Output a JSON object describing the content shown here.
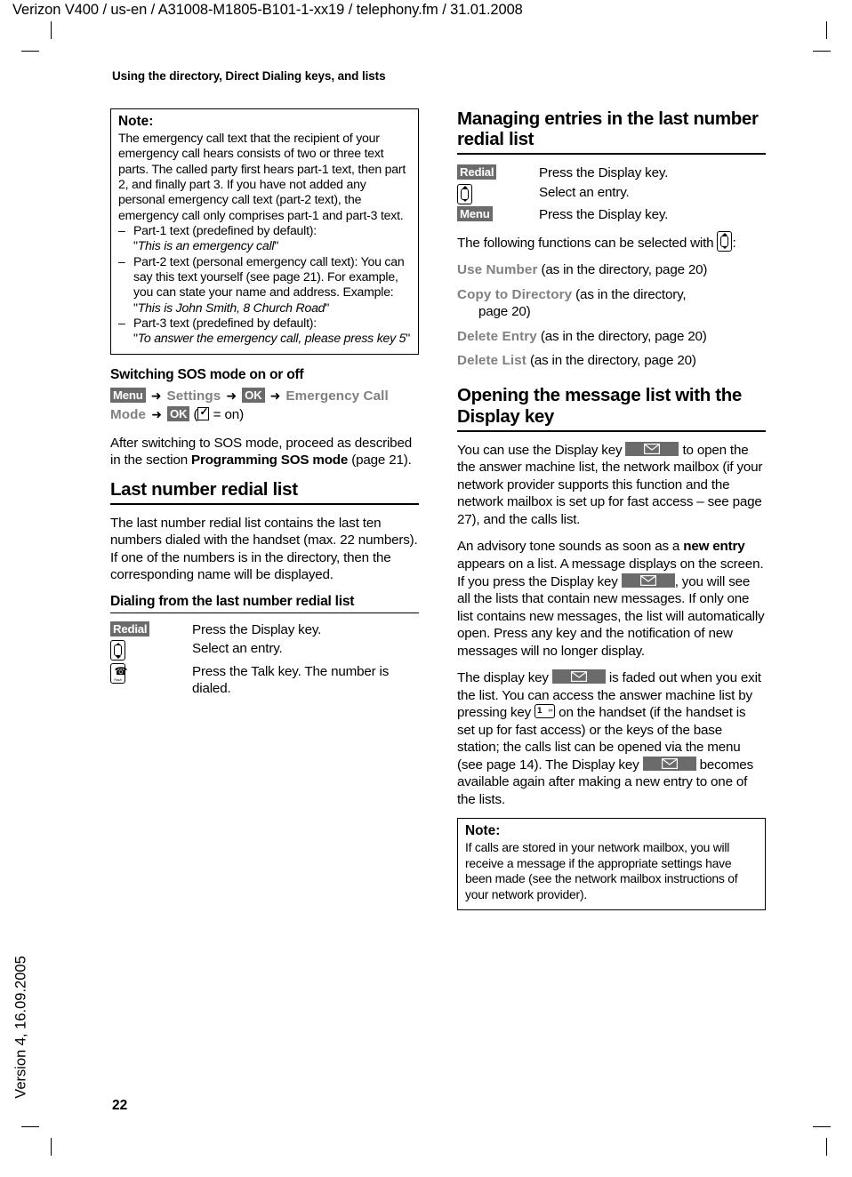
{
  "running_head": "Verizon V400 / us-en / A31008-M1805-B101-1-xx19 / telephony.fm / 31.01.2008",
  "section_title": "Using the directory, Direct Dialing keys, and lists",
  "version_sidebar": "Version 4, 16.09.2005",
  "page_number": "22",
  "colors": {
    "badge_background": "#6b6b6b",
    "badge_text": "#ffffff",
    "menu_word": "#808080",
    "text": "#000000",
    "rule": "#000000"
  },
  "left_column": {
    "note_box": {
      "title": "Note:",
      "paragraph": "The emergency call text that the recipient of your emergency call hears consists of two or three text parts. The called party first hears part-1 text, then part 2, and finally part 3. If you have not added any personal emergency call text (part-2 text), the emergency call only comprises part-1 and part-3 text.",
      "items": [
        {
          "dash": "–",
          "lead": "Part-1 text (predefined by default):",
          "quote_open": "\"",
          "italic": "This is an emergency call",
          "quote_close": "\""
        },
        {
          "dash": "–",
          "lead": "Part-2 text (personal emergency call text): You can say this text yourself (see page 21). For example, you can state your name and address. Example:",
          "quote_open": "\"",
          "italic": "This is John Smith, 8 Church Road",
          "quote_close": "\""
        },
        {
          "dash": "–",
          "lead": "Part-3 text (predefined by default):",
          "quote_open": "\"",
          "italic": "To answer the emergency call, please press key 5",
          "quote_close": "\""
        }
      ]
    },
    "sos_heading": "Switching SOS mode on or off",
    "sos_path": {
      "menu_label": "Menu",
      "arrow": "➜",
      "settings_label": "Settings",
      "ok_label_1": "OK",
      "emergency_label": "Emergency Call Mode",
      "ok_label_2": "OK",
      "paren_open": "(",
      "equals_on": "= on",
      "paren_close": ")"
    },
    "sos_paragraph_pre": "After switching to SOS mode, proceed as described in the section ",
    "sos_paragraph_bold": "Programming SOS mode",
    "sos_paragraph_post": " (page 21).",
    "redial_heading": "Last number redial list",
    "redial_paragraph": "The last number redial list contains the last ten numbers dialed with the handset (max. 22 numbers). If one of the numbers is in the directory, then the corresponding name will be displayed.",
    "dialing_heading": "Dialing from the last number redial list",
    "dialing_steps": [
      {
        "key": "Redial",
        "key_type": "badge",
        "text": "Press the Display key."
      },
      {
        "key": "nav-key",
        "key_type": "icon-nav",
        "text": "Select an entry."
      },
      {
        "key": "talk-key",
        "key_type": "icon-talk",
        "text": "Press the Talk key. The number is dialed."
      }
    ],
    "talk_key_sublabel": "Flash"
  },
  "right_column": {
    "managing_heading": "Managing entries in the last number redial list",
    "managing_steps": [
      {
        "key": "Redial",
        "key_type": "badge",
        "text": "Press the Display key."
      },
      {
        "key": "nav-key",
        "key_type": "icon-nav",
        "text": "Select an entry."
      },
      {
        "key": "Menu",
        "key_type": "badge",
        "text": "Press the Display key."
      }
    ],
    "functions_intro_pre": "The following functions can be selected with ",
    "functions_intro_post": ":",
    "functions": [
      {
        "name": "Use  Number",
        "rest": " (as in the directory, page 20)"
      },
      {
        "name": "Copy to  Directory",
        "rest": " (as in the directory,",
        "cont": "page 20)"
      },
      {
        "name": "Delete Entry",
        "rest": " (as in the directory, page 20)"
      },
      {
        "name": "Delete List",
        "rest": " (as in the directory, page 20)"
      }
    ],
    "message_heading": "Opening the message list with the Display key",
    "para1_a": "You can use the Display key ",
    "para1_b": " to open the the answer machine list, the network mailbox (if your network provider supports this function and the network mailbox is set up for fast access – see page 27), and the calls list.",
    "para2_a": "An advisory tone sounds as soon as a ",
    "para2_bold": "new entry",
    "para2_b": " appears on a list. A message displays on the screen. If you press the Display key ",
    "para2_c": ", you will see all the lists that contain new messages. If only one list contains new messages, the list will automatically open. Press any key and the notification of new messages will no longer display.",
    "para3_a": "The display key ",
    "para3_b": " is faded out when you exit the list. You can access the answer machine list by pressing key ",
    "para3_c": " on the handset (if the handset is set up for fast access) or the keys of the base station; the calls list can be opened via the menu (see page 14). The Display key ",
    "para3_d": " becomes available again after making a new entry to one of the lists.",
    "num_key_digit": "1",
    "note_box": {
      "title": "Note:",
      "text": "If calls are stored in your network mailbox, you will receive a message if the appropriate settings have been made (see the network mailbox instructions of your network provider)."
    }
  }
}
